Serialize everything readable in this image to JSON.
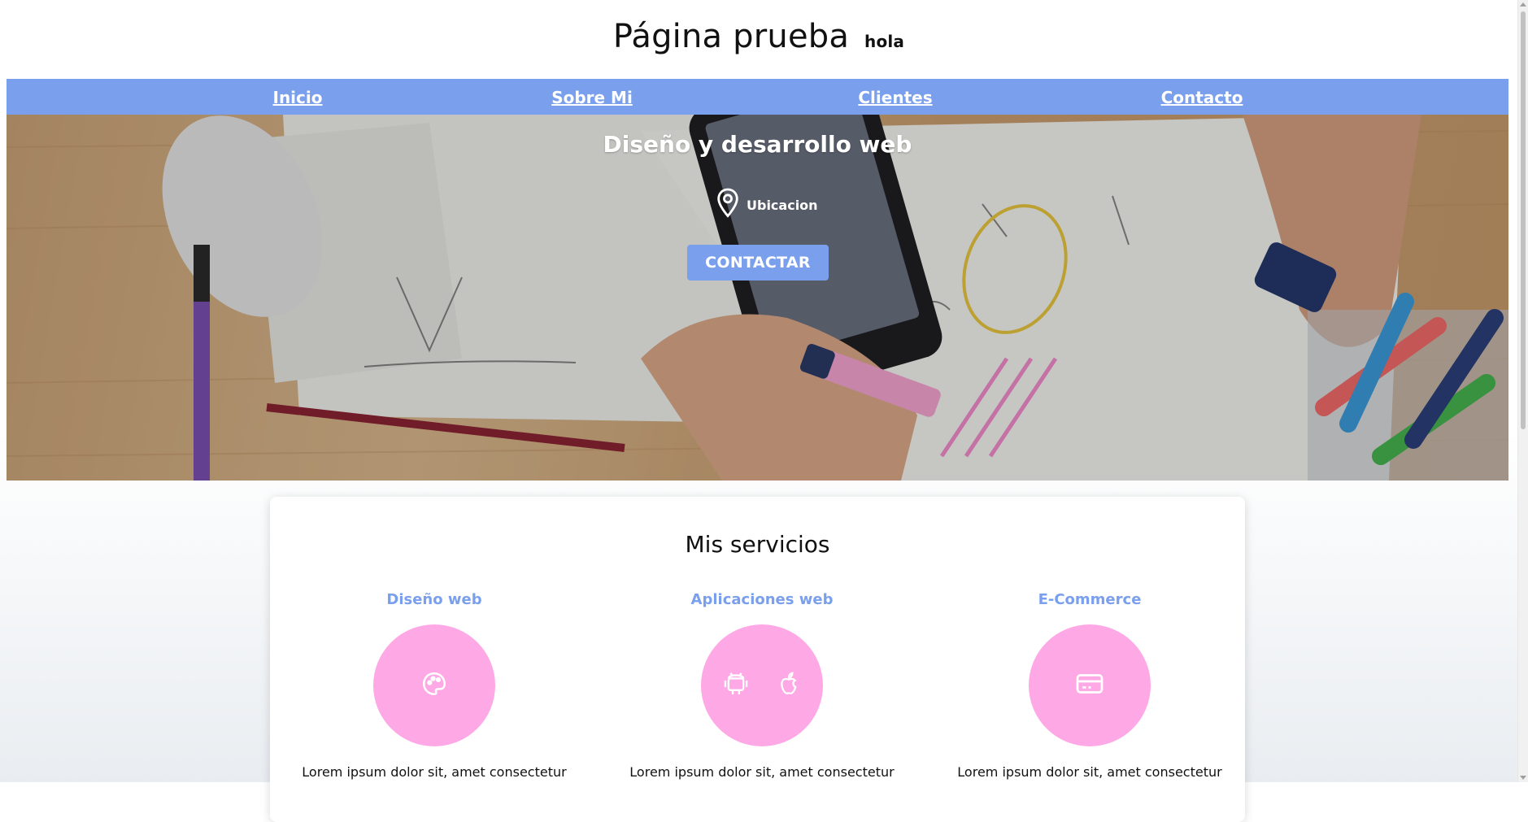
{
  "header": {
    "title": "Página prueba",
    "subtitle": "hola"
  },
  "nav": {
    "items": [
      {
        "label": "Inicio"
      },
      {
        "label": "Sobre Mi"
      },
      {
        "label": "Clientes"
      },
      {
        "label": "Contacto"
      }
    ]
  },
  "hero": {
    "heading": "Diseño y desarrollo web",
    "location": "Ubicacion",
    "button": "CONTACTAR"
  },
  "services": {
    "title": "Mis servicios",
    "items": [
      {
        "name": "Diseño web",
        "icons": [
          "palette-icon"
        ],
        "desc": "Lorem ipsum dolor sit, amet consectetur"
      },
      {
        "name": "Aplicaciones web",
        "icons": [
          "android-icon",
          "apple-icon"
        ],
        "desc": "Lorem ipsum dolor sit, amet consectetur"
      },
      {
        "name": "E-Commerce",
        "icons": [
          "credit-card-icon"
        ],
        "desc": "Lorem ipsum dolor sit, amet consectetur"
      }
    ]
  },
  "colors": {
    "nav": "#7a9fec",
    "accent": "#7a9fec",
    "circle": "#ffa8e6"
  }
}
